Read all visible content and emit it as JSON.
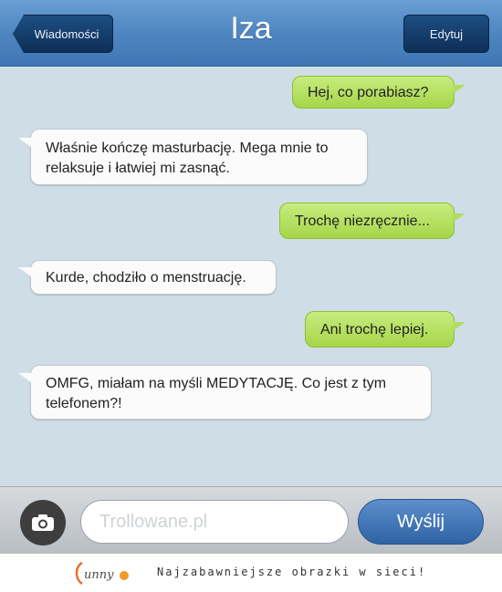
{
  "header": {
    "back_label": "Wiadomości",
    "title": "Iza",
    "edit_label": "Edytuj"
  },
  "messages": [
    {
      "direction": "outgoing",
      "text": "Hej, co porabiasz?"
    },
    {
      "direction": "incoming",
      "line1": "Właśnie kończę masturbację. Mega mnie to",
      "line2": "relaksuje i łatwiej mi zasnąć."
    },
    {
      "direction": "outgoing",
      "text": "Trochę niezręcznie..."
    },
    {
      "direction": "incoming",
      "text": "Kurde, chodziło o menstruację."
    },
    {
      "direction": "outgoing",
      "text": "Ani trochę lepiej."
    },
    {
      "direction": "incoming",
      "line1": "OMFG, miałam na myśli MEDYTACJĘ. Co jest z tym",
      "line2": "telefonem?!"
    }
  ],
  "input": {
    "placeholder": "Trollowane.pl",
    "send_label": "Wyślij",
    "camera_icon": "camera-icon"
  },
  "footer": {
    "logo_text": "Funny",
    "tagline": "Najzabawniejsze obrazki w sieci!"
  },
  "colors": {
    "header": "#4f86c1",
    "conversation_bg": "#cfdee6",
    "outgoing_bubble": "#b3dd5e",
    "incoming_bubble": "#fbfbfb",
    "send_button": "#3f75b8"
  }
}
